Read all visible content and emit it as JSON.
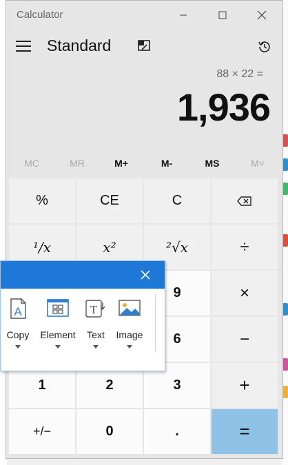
{
  "window": {
    "app_title": "Calculator",
    "mode_title": "Standard"
  },
  "display": {
    "expression": "88 × 22 =",
    "result": "1,936"
  },
  "memory": [
    {
      "label": "MC",
      "enabled": false
    },
    {
      "label": "MR",
      "enabled": false
    },
    {
      "label": "M+",
      "enabled": true
    },
    {
      "label": "M-",
      "enabled": true
    },
    {
      "label": "MS",
      "enabled": true
    },
    {
      "label": "M˅",
      "enabled": false
    }
  ],
  "keys": {
    "percent": "%",
    "ce": "CE",
    "clear": "C",
    "reciprocal": "¹/x",
    "square": "x²",
    "sqrt": "²√x",
    "divide": "÷",
    "nine": "9",
    "multiply": "×",
    "six": "6",
    "minus": "−",
    "one": "1",
    "two": "2",
    "three": "3",
    "plus": "+",
    "negate": "+/−",
    "zero": "0",
    "decimal": ".",
    "equals": "="
  },
  "snip_toolbar": {
    "tools": [
      {
        "label": "Copy",
        "icon": "copy-text-icon"
      },
      {
        "label": "Element",
        "icon": "element-grid-icon"
      },
      {
        "label": "Text",
        "icon": "text-tool-icon"
      },
      {
        "label": "Image",
        "icon": "image-icon"
      }
    ]
  },
  "colors": {
    "equals_key": "#8ec2e6",
    "snip_header": "#1e78d7",
    "window_bg": "#e6e6e6"
  }
}
